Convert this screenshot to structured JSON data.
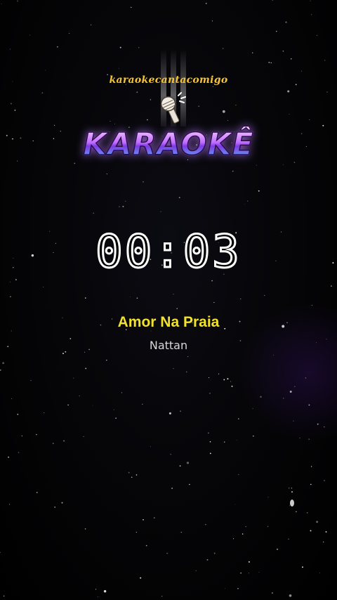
{
  "header": {
    "site_name": "karaokecantacomigo",
    "brand_word": "KARAOKÊ",
    "mic_icon": "microphone-icon"
  },
  "player": {
    "timer": "00:03",
    "song_title": "Amor Na Praia",
    "artist": "Nattan"
  },
  "colors": {
    "title_yellow": "#f3e22c",
    "site_name_gold": "#f6c431",
    "artist_gray": "#d8d8d8",
    "background": "#000000"
  }
}
